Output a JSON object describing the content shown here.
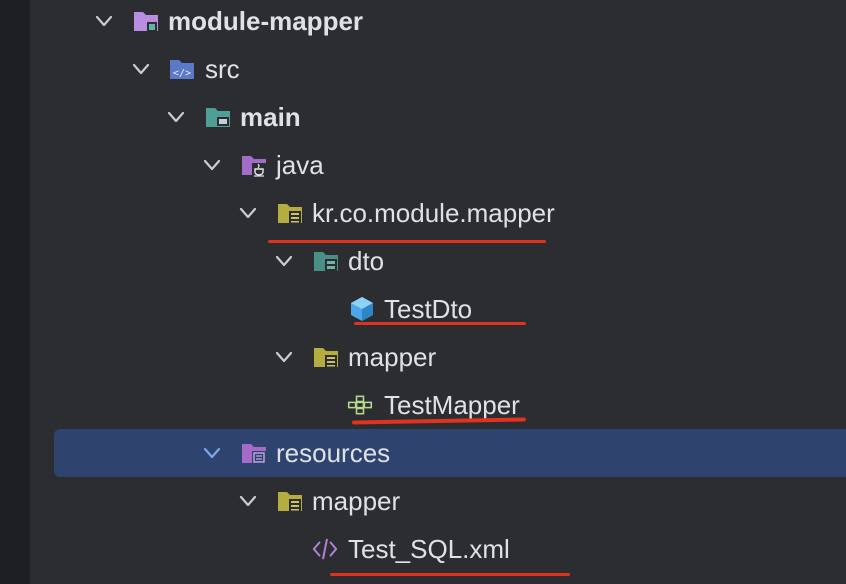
{
  "project_tree": {
    "nodes": [
      {
        "label": "module-mapper",
        "icon": "module-folder-icon",
        "expanded": true,
        "depth": 0
      },
      {
        "label": "src",
        "icon": "source-folder-icon",
        "expanded": true,
        "depth": 1
      },
      {
        "label": "main",
        "icon": "main-folder-icon",
        "expanded": true,
        "depth": 2
      },
      {
        "label": "java",
        "icon": "java-sources-folder-icon",
        "expanded": true,
        "depth": 3
      },
      {
        "label": "kr.co.module.mapper",
        "icon": "package-icon",
        "expanded": true,
        "depth": 4
      },
      {
        "label": "dto",
        "icon": "package-icon",
        "expanded": true,
        "depth": 5
      },
      {
        "label": "TestDto",
        "icon": "record-class-icon",
        "depth": 6
      },
      {
        "label": "mapper",
        "icon": "package-icon",
        "expanded": true,
        "depth": 5
      },
      {
        "label": "TestMapper",
        "icon": "mybatis-mapper-icon",
        "depth": 6
      },
      {
        "label": "resources",
        "icon": "resources-folder-icon",
        "expanded": true,
        "selected": true,
        "depth": 3
      },
      {
        "label": "mapper",
        "icon": "package-icon",
        "expanded": true,
        "depth": 4
      },
      {
        "label": "Test_SQL.xml",
        "icon": "xml-file-icon",
        "depth": 5
      }
    ]
  },
  "colors": {
    "background": "#2b2d30",
    "selection": "#2e436e",
    "annotation_underline": "#e0321f",
    "text": "#dfe1e5"
  }
}
